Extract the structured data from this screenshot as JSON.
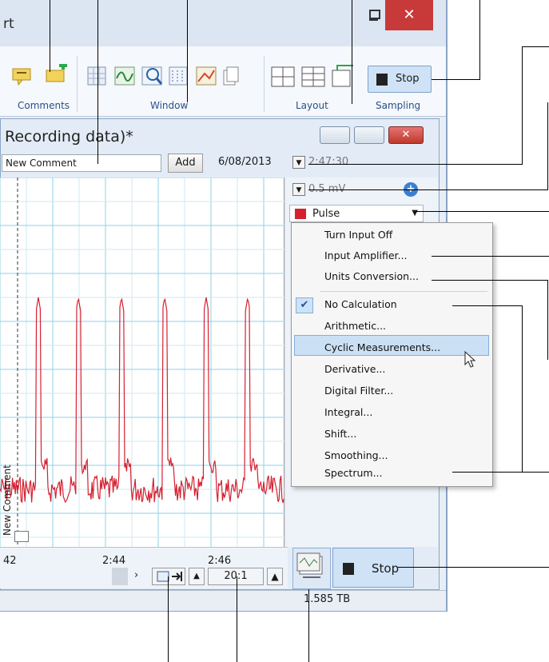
{
  "window": {
    "title_fragment": "rt",
    "close_glyph": "✕"
  },
  "ribbon": {
    "groups": {
      "comments": "Comments",
      "window": "Window",
      "layout": "Layout",
      "sampling": "Sampling"
    },
    "stop_label": "Stop"
  },
  "document": {
    "title": "Recording data)*",
    "close_glyph": "✕",
    "comment_input_value": "New Comment",
    "add_label": "Add",
    "date": "6/08/2013",
    "time": "2:47:30",
    "range": "0.5 mV",
    "channel_name": "Pulse",
    "channel_color": "#d62030",
    "plot_comment_marker": "New Comment",
    "time_ticks": [
      "42",
      "2:44",
      "2:46"
    ],
    "zoom_ratio": "20:1",
    "stop_label": "Stop",
    "status_disk": "1.585 TB"
  },
  "channel_menu": {
    "items_top": [
      "Turn Input Off",
      "Input Amplifier...",
      "Units Conversion..."
    ],
    "items_calc": [
      "No Calculation",
      "Arithmetic...",
      "Cyclic Measurements...",
      "Derivative...",
      "Digital Filter...",
      "Integral...",
      "Shift...",
      "Smoothing...",
      "Spectrum..."
    ],
    "checked_item": "No Calculation",
    "highlighted_item": "Cyclic Measurements..."
  },
  "icons": [
    "comment-icon",
    "add-comment-icon",
    "window-icons",
    "layout-icons",
    "stop-icon",
    "plus-icon",
    "checkmark-icon",
    "mouse-cursor-icon",
    "sampler-icon"
  ]
}
